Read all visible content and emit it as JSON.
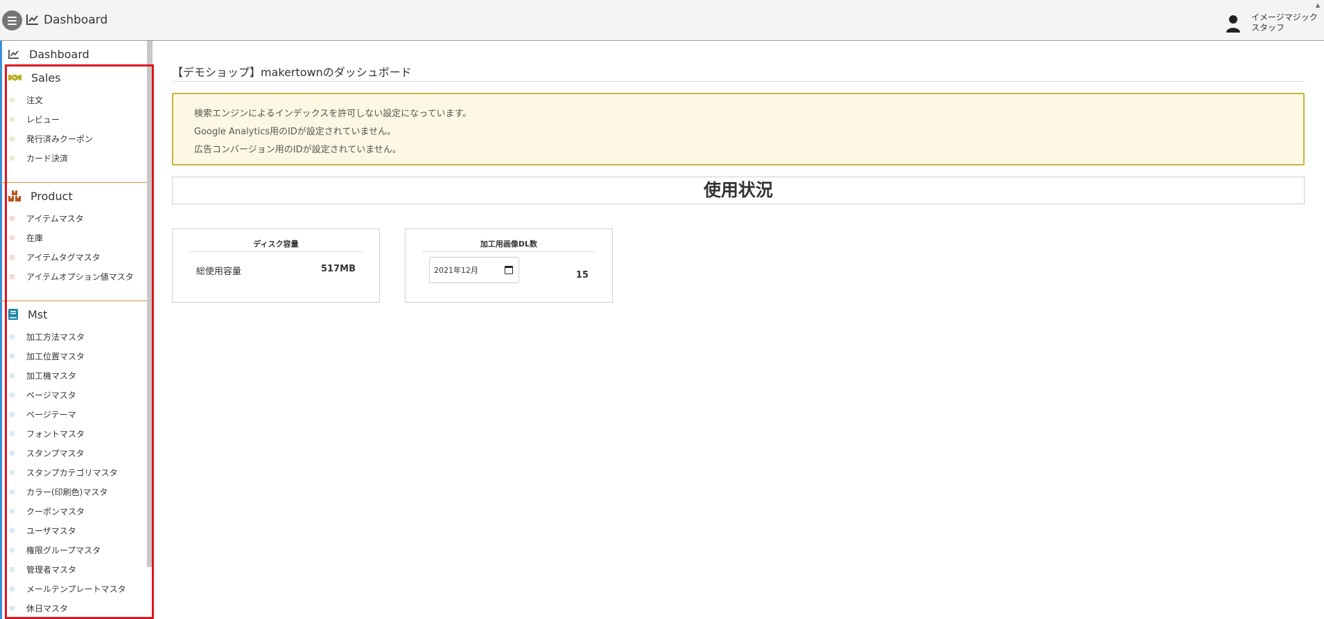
{
  "header": {
    "title": "Dashboard",
    "user_name_line1": "イメージマジック",
    "user_name_line2": "スタッフ"
  },
  "sidebar": {
    "dashboard_label": "Dashboard",
    "sections": [
      {
        "title": "Sales",
        "icon": "handshake-icon",
        "accent": "#b9b22a",
        "items": [
          "注文",
          "レビュー",
          "発行済みクーポン",
          "カード決済"
        ]
      },
      {
        "title": "Product",
        "icon": "boxes-icon",
        "accent": "#b5561e",
        "items": [
          "アイテムマスタ",
          "在庫",
          "アイテムタグマスタ",
          "アイテムオプション値マスタ"
        ]
      },
      {
        "title": "Mst",
        "icon": "book-icon",
        "accent": "#1e88a8",
        "items": [
          "加工方法マスタ",
          "加工位置マスタ",
          "加工機マスタ",
          "ページマスタ",
          "ページテーマ",
          "フォントマスタ",
          "スタンプマスタ",
          "スタンプカテゴリマスタ",
          "カラー(印刷色)マスタ",
          "クーポンマスタ",
          "ユーザマスタ",
          "権限グループマスタ",
          "管理者マスタ",
          "メールテンプレートマスタ",
          "休日マスタ"
        ]
      }
    ]
  },
  "main": {
    "page_heading": "【デモショップ】makertownのダッシュボード",
    "alerts": [
      "検索エンジンによるインデックスを許可しない設定になっています。",
      "Google Analytics用のIDが設定されていません。",
      "広告コンバージョン用のIDが設定されていません。"
    ],
    "usage_title": "使用状況",
    "disk_card": {
      "title": "ディスク容量",
      "label": "総使用容量",
      "value": "517MB"
    },
    "dl_card": {
      "title": "加工用画像DL数",
      "month_value": "2021年12月",
      "count": "15"
    }
  },
  "colors": {
    "alert_bg": "#fcf8e3",
    "alert_border": "#c9b43a",
    "highlight": "#e0141e"
  }
}
